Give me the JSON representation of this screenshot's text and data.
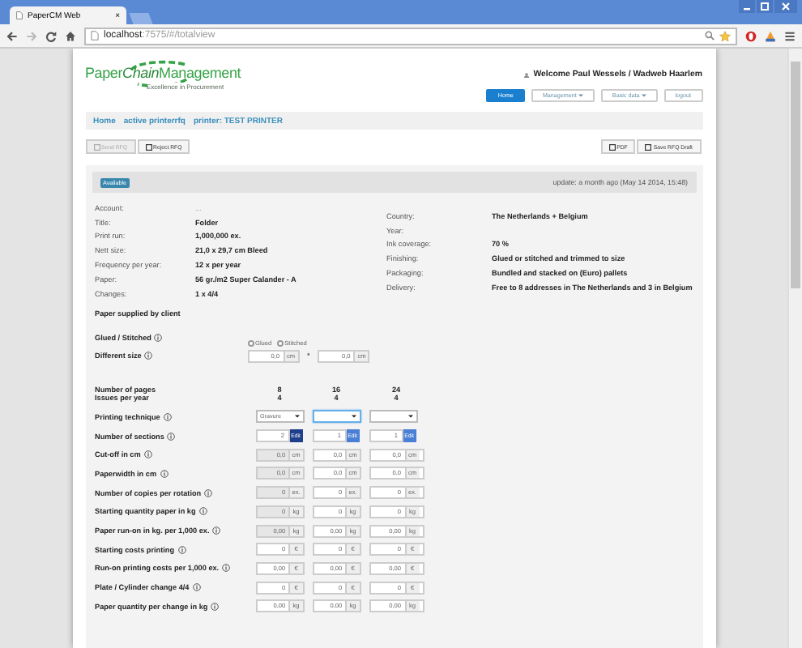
{
  "browser": {
    "tab_title": "PaperCM Web",
    "tab_close": "×",
    "url_host": "localhost",
    "url_path": ":7575/#/totalview"
  },
  "header": {
    "logo": [
      "Paper",
      "Chain",
      "Management"
    ],
    "tagline": "Excellence in Procurement",
    "welcome": "Welcome Paul Wessels / Wadweb Haarlem",
    "nav": [
      {
        "label": "Home",
        "selected": true,
        "dropdown": false
      },
      {
        "label": "Management",
        "selected": false,
        "dropdown": true
      },
      {
        "label": "Basic data",
        "selected": false,
        "dropdown": true
      },
      {
        "label": "logout",
        "selected": false,
        "dropdown": false
      }
    ]
  },
  "breadcrumb": [
    "Home",
    "active printerrfq",
    "printer: TEST PRINTER"
  ],
  "toolbar": {
    "left": [
      {
        "label": "Send RFQ",
        "disabled": true
      },
      {
        "label": "Reject RFQ",
        "disabled": false
      }
    ],
    "right": [
      {
        "label": "PDF",
        "disabled": false
      },
      {
        "label": "Save RFQ Draft",
        "disabled": false
      }
    ]
  },
  "card": {
    "status": "Available",
    "updated": "update: a month ago (May 14 2014, 15:48)",
    "info_left": [
      {
        "label": "Account:",
        "value": "...",
        "muted": true
      },
      {
        "label": "Title:",
        "value": "Folder",
        "muted": false
      },
      {
        "label": "Print run:",
        "value": "1,000,000 ex.",
        "muted": false
      },
      {
        "label": "Nett size:",
        "value": "21,0 x 29,7 cm  Bleed",
        "muted": false
      },
      {
        "label": "Frequency per year:",
        "value": "12 x per year",
        "muted": false
      },
      {
        "label": "Paper:",
        "value": "56 gr./m2 Super Calander - A",
        "muted": false
      },
      {
        "label": "Changes:",
        "value": "1  x  4/4",
        "muted": false
      }
    ],
    "info_right": [
      {
        "label": "Country:",
        "value": "The Netherlands + Belgium"
      },
      {
        "label": "Year:"
      },
      {
        "label": "Ink coverage:",
        "value": "70 %"
      },
      {
        "label": "Finishing:",
        "value": "Glued or stitched and trimmed to size"
      },
      {
        "label": "Packaging:",
        "value": "Bundled and stacked on (Euro) pallets"
      },
      {
        "label": "Delivery:",
        "value": "Free to 8 addresses in The Netherlands and 3 in Belgium"
      }
    ],
    "note": "Paper supplied by client",
    "glued_stitched": {
      "label": "Glued / Stitched",
      "options": [
        {
          "label": "Glued",
          "selected": false
        },
        {
          "label": "Stitched",
          "selected": false
        }
      ]
    },
    "different_size": {
      "label": "Different size",
      "separator": "*",
      "fields": [
        {
          "value": "0,0",
          "unit": "cm"
        },
        {
          "value": "0,0",
          "unit": "cm"
        }
      ]
    },
    "pages": [
      {
        "label": "Number of pages",
        "values": [
          "8",
          "16",
          "24"
        ]
      },
      {
        "label": "Issues per year",
        "values": [
          "4",
          "4",
          "4"
        ]
      }
    ],
    "rows": [
      {
        "kind": "select",
        "label": "Printing technique",
        "cells": [
          {
            "value": "Gravure",
            "focused": false
          },
          {
            "focused": true
          },
          {
            "focused": false
          }
        ]
      },
      {
        "kind": "edit",
        "label": "Number of sections",
        "cells": [
          {
            "value": "2",
            "button": "Edit",
            "active": true
          },
          {
            "value": "1",
            "button": "Edit",
            "active": false
          },
          {
            "value": "1",
            "button": "Edit",
            "active": false
          }
        ]
      },
      {
        "kind": "unit",
        "label": "Cut-off in cm",
        "cells": [
          {
            "value": "0,0",
            "unit": "cm",
            "disabled": true
          },
          {
            "value": "0,0",
            "unit": "cm",
            "disabled": false
          },
          {
            "value": "0,0",
            "unit": "cm",
            "disabled": false
          }
        ]
      },
      {
        "kind": "unit",
        "label": "Paperwidth in cm",
        "cells": [
          {
            "value": "0,0",
            "unit": "cm",
            "disabled": true
          },
          {
            "value": "0,0",
            "unit": "cm",
            "disabled": false
          },
          {
            "value": "0,0",
            "unit": "cm",
            "disabled": false
          }
        ]
      },
      {
        "kind": "unit",
        "label": "Number of copies per rotation",
        "cells": [
          {
            "value": "0",
            "unit": "ex.",
            "disabled": true
          },
          {
            "value": "0",
            "unit": "ex.",
            "disabled": false
          },
          {
            "value": "0",
            "unit": "ex.",
            "disabled": false
          }
        ]
      },
      {
        "kind": "unit",
        "label": "Starting quantity paper in kg",
        "cells": [
          {
            "value": "0",
            "unit": "kg",
            "disabled": true
          },
          {
            "value": "0",
            "unit": "kg",
            "disabled": false
          },
          {
            "value": "0",
            "unit": "kg",
            "disabled": false
          }
        ]
      },
      {
        "kind": "unit",
        "label": "Paper run-on in kg. per 1,000 ex.",
        "cells": [
          {
            "value": "0,00",
            "unit": "kg",
            "disabled": true
          },
          {
            "value": "0,00",
            "unit": "kg",
            "disabled": false
          },
          {
            "value": "0,00",
            "unit": "kg",
            "disabled": false
          }
        ]
      },
      {
        "kind": "unit",
        "label": "Starting costs printing",
        "cells": [
          {
            "value": "0",
            "unit": "€",
            "disabled": false
          },
          {
            "value": "0",
            "unit": "€",
            "disabled": false
          },
          {
            "value": "0",
            "unit": "€",
            "disabled": false
          }
        ]
      },
      {
        "kind": "unit",
        "label": "Run-on printing costs per 1,000 ex.",
        "cells": [
          {
            "value": "0,00",
            "unit": "€",
            "disabled": false
          },
          {
            "value": "0,00",
            "unit": "€",
            "disabled": false
          },
          {
            "value": "0,00",
            "unit": "€",
            "disabled": false
          }
        ]
      },
      {
        "kind": "unit",
        "label": "Plate / Cylinder change 4/4",
        "cells": [
          {
            "value": "0",
            "unit": "€",
            "disabled": false
          },
          {
            "value": "0",
            "unit": "€",
            "disabled": false
          },
          {
            "value": "0",
            "unit": "€",
            "disabled": false
          }
        ]
      },
      {
        "kind": "unit",
        "label": "Paper quantity per change in kg",
        "cells": [
          {
            "value": "0,00",
            "unit": "kg",
            "disabled": false
          },
          {
            "value": "0,00",
            "unit": "kg",
            "disabled": false
          },
          {
            "value": "0,00",
            "unit": "kg",
            "disabled": false
          }
        ]
      }
    ]
  }
}
